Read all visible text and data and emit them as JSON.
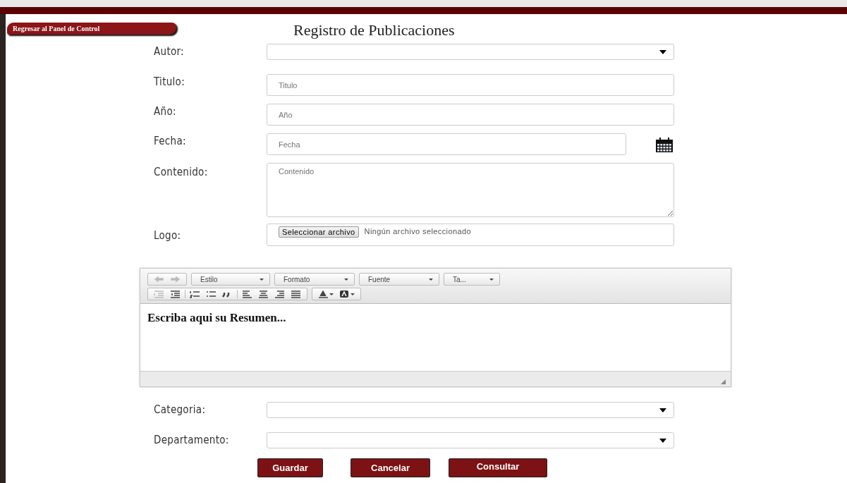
{
  "back_button": "Regresar al Panel de Control",
  "title": "Registro de Publicaciones",
  "fields": [
    {
      "kind": "select",
      "label": "Autor:"
    },
    {
      "kind": "text",
      "label": "Titulo:",
      "placeholder": "Titulo"
    },
    {
      "kind": "text",
      "label": "Año:",
      "placeholder": "Año"
    },
    {
      "kind": "date",
      "label": "Fecha:",
      "placeholder": "Fecha"
    },
    {
      "kind": "textarea",
      "label": "Contenido:",
      "placeholder": "Contenido"
    },
    {
      "kind": "file",
      "label": "Logo:",
      "button": "Seleccionar archivo",
      "status": "Ningún archivo seleccionado"
    }
  ],
  "editor": {
    "toolbar_rows": [
      [
        {
          "group": [
            {
              "kind": "undo",
              "disabled": true
            },
            {
              "kind": "redo",
              "disabled": true
            }
          ]
        },
        {
          "combo": "Estilo"
        },
        {
          "combo": "Formato"
        },
        {
          "combo": "Fuente"
        },
        {
          "combo": "Ta..."
        }
      ],
      [
        {
          "group": [
            {
              "kind": "outdent",
              "disabled": true
            },
            {
              "kind": "indent",
              "disabled": false
            },
            {
              "kind": "sep"
            },
            {
              "kind": "numbered-list",
              "disabled": false
            },
            {
              "kind": "bullet-list",
              "disabled": false
            },
            {
              "kind": "quote",
              "disabled": false
            },
            {
              "kind": "sep"
            },
            {
              "kind": "align-left",
              "disabled": false
            },
            {
              "kind": "align-center",
              "disabled": false
            },
            {
              "kind": "align-right",
              "disabled": false
            },
            {
              "kind": "justify",
              "disabled": false
            }
          ]
        },
        {
          "group": [
            {
              "kind": "text-color",
              "disabled": false
            },
            {
              "kind": "bg-color",
              "disabled": false
            }
          ]
        }
      ]
    ],
    "content": "Escriba aqui su Resumen..."
  },
  "fields_after": [
    {
      "kind": "select",
      "label": "Categoria:"
    },
    {
      "kind": "select",
      "label": "Departamento:"
    }
  ],
  "buttons": [
    "Guardar",
    "Cancelar",
    "Consultar"
  ]
}
